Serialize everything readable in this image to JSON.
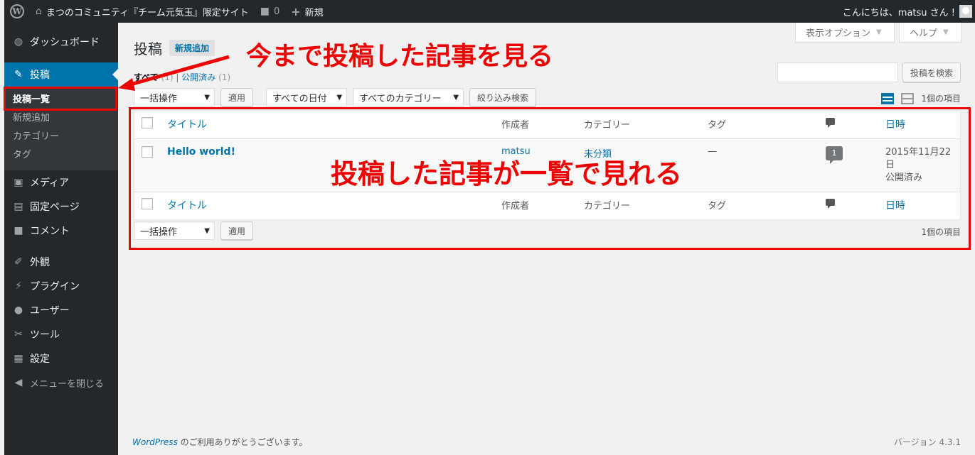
{
  "adminbar": {
    "site_name": "まつのコミュニティ『チーム元気玉』限定サイト",
    "comments_count": "0",
    "new_label": "新規",
    "greeting": "こんにちは、matsu さん !"
  },
  "sidebar": {
    "items": [
      {
        "icon": "dashboard-icon",
        "label": "ダッシュボード"
      },
      {
        "icon": "pin-icon",
        "label": "投稿"
      },
      {
        "icon": "media-icon",
        "label": "メディア"
      },
      {
        "icon": "page-icon",
        "label": "固定ページ"
      },
      {
        "icon": "comment-icon",
        "label": "コメント"
      },
      {
        "icon": "brush-icon",
        "label": "外観"
      },
      {
        "icon": "plugin-icon",
        "label": "プラグイン"
      },
      {
        "icon": "user-icon",
        "label": "ユーザー"
      },
      {
        "icon": "wrench-icon",
        "label": "ツール"
      },
      {
        "icon": "settings-icon",
        "label": "設定"
      }
    ],
    "submenu": [
      "投稿一覧",
      "新規追加",
      "カテゴリー",
      "タグ"
    ],
    "collapse_label": "メニューを閉じる"
  },
  "screen_options": {
    "display": "表示オプション",
    "help": "ヘルプ"
  },
  "page": {
    "title": "投稿",
    "add_new": "新規追加",
    "views": {
      "all": "すべて",
      "all_count": "(1)",
      "separator": "|",
      "published": "公開済み",
      "published_count": "(1)"
    },
    "search_button": "投稿を検索",
    "bulk_action": "一括操作",
    "apply": "適用",
    "date_filter": "すべての日付",
    "category_filter": "すべてのカテゴリー",
    "filter_button": "絞り込み検索",
    "items_count": "1個の項目"
  },
  "table": {
    "columns": {
      "title": "タイトル",
      "author": "作成者",
      "categories": "カテゴリー",
      "tags": "タグ",
      "date": "日時"
    },
    "rows": [
      {
        "title": "Hello world!",
        "author": "matsu",
        "category": "未分類",
        "tags": "—",
        "comments": "1",
        "date_line1": "2015年11月22",
        "date_line2": "日",
        "status": "公開済み"
      }
    ]
  },
  "footer": {
    "wordpress": "WordPress",
    "thanks": " のご利用ありがとうございます。",
    "version": "バージョン 4.3.1"
  },
  "annotations": {
    "top_note": "今まで投稿した記事を見る",
    "table_note": "投稿した記事が一覧で見れる",
    "color": "#e00000"
  },
  "colors": {
    "accent": "#0073aa",
    "sidebar_bg": "#23282d"
  }
}
